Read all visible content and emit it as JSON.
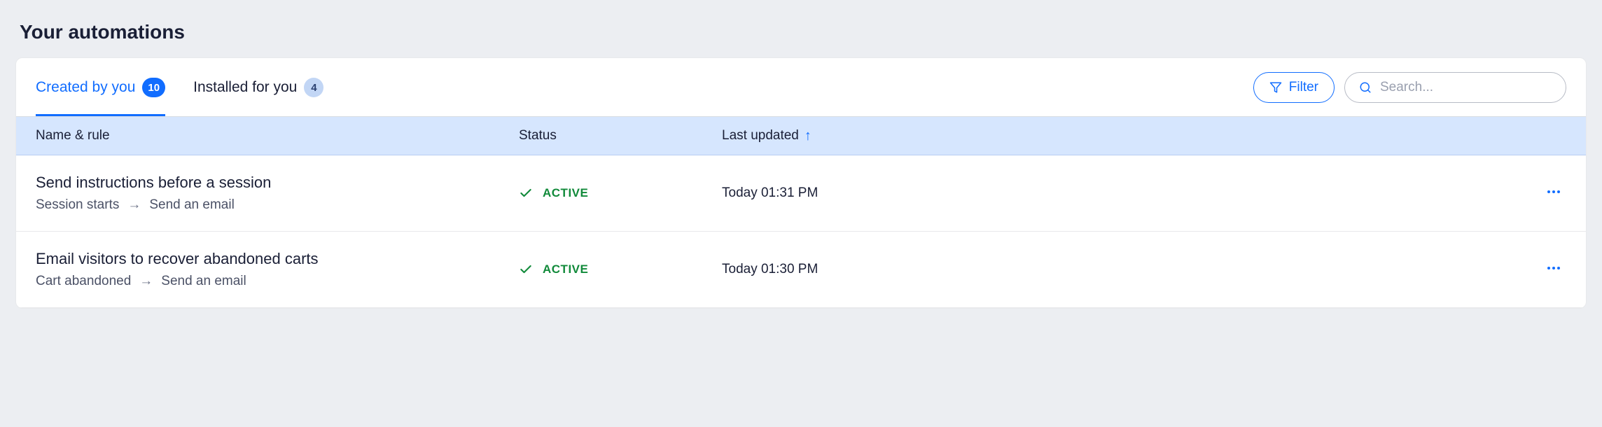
{
  "page": {
    "title": "Your automations"
  },
  "tabs": [
    {
      "label": "Created by you",
      "count": "10",
      "active": true
    },
    {
      "label": "Installed for you",
      "count": "4",
      "active": false
    }
  ],
  "controls": {
    "filter_label": "Filter",
    "search_placeholder": "Search..."
  },
  "columns": {
    "name": "Name & rule",
    "status": "Status",
    "updated": "Last updated"
  },
  "rows": [
    {
      "name": "Send instructions before a session",
      "trigger": "Session starts",
      "action": "Send an email",
      "status": "ACTIVE",
      "updated": "Today 01:31 PM"
    },
    {
      "name": "Email visitors to recover abandoned carts",
      "trigger": "Cart abandoned",
      "action": "Send an email",
      "status": "ACTIVE",
      "updated": "Today 01:30 PM"
    }
  ]
}
